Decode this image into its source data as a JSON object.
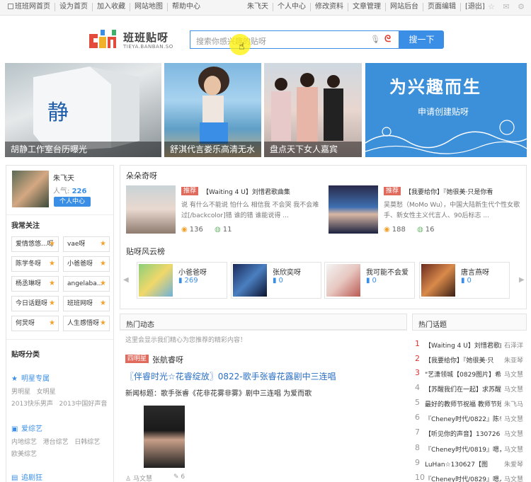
{
  "topbar": {
    "left_links": [
      "班班网首页",
      "设为首页",
      "加入收藏",
      "网站地图",
      "帮助中心"
    ],
    "right_links": [
      "朱飞天",
      "个人中心",
      "修改资料",
      "文章管理",
      "网站后台",
      "页面编辑",
      "[退出]"
    ],
    "icons": [
      "pin-icon",
      "star-icon",
      "mail-icon",
      "settings-icon"
    ]
  },
  "logo": {
    "cn": "班班贴呀",
    "en": "TIEYA.BANBAN.SO"
  },
  "search": {
    "placeholder": "搜索你感兴趣的贴呀",
    "button": "搜一下"
  },
  "banners": [
    {
      "caption": "胡静工作室台历曝光"
    },
    {
      "caption": "舒淇代言娄乐高清无水"
    },
    {
      "caption": "盘点天下女人嘉宾"
    },
    {
      "caption": "",
      "big": "为兴趣而生",
      "sub": "申请创建贴呀"
    }
  ],
  "user": {
    "name": "朱飞天",
    "popular_label": "人气:",
    "popular_value": "226",
    "center_button": "个人中心"
  },
  "follow": {
    "title": "我常关注",
    "items": [
      "爱情悠悠...呀",
      "vae呀",
      "陈学冬呀",
      "小爸爸呀",
      "杨丞琳呀",
      "angelaba...",
      "今日话题呀",
      "班班网呀",
      "何炅呀",
      "人生感悟呀"
    ]
  },
  "categories": {
    "title": "贴呀分类",
    "groups": [
      {
        "name": "明星专属",
        "subs": [
          "男明星",
          "女明星",
          "2013快乐男声",
          "2013中国好声音"
        ]
      },
      {
        "name": "爱综艺",
        "subs": [
          "内地综艺",
          "港台综艺",
          "日韩综艺",
          "欧美综艺"
        ]
      },
      {
        "name": "追剧狂",
        "subs": []
      }
    ]
  },
  "duoduo": {
    "title": "朵朵奇呀",
    "items": [
      {
        "badge": "推荐",
        "title": "【Waiting 4 U】刘惜君歌曲集",
        "desc": "说 有什么不能说 怕什么 相信我 不会哭 我不会难过[/backcolor]错 谁的错 谁能说得 ...",
        "views": "136",
        "comments": "11"
      },
      {
        "badge": "推荐",
        "title": "【我要给你】『她很美·只是你看",
        "desc": "吴莫愁（MoMo Wu），中国大陆新生代个性女歌手、新女性主义代言人、90后标志 ...",
        "views": "188",
        "comments": "16"
      }
    ]
  },
  "ranking": {
    "title": "贴呀风云榜",
    "items": [
      {
        "name": "小爸爸呀",
        "count": "269"
      },
      {
        "name": "张欣奕呀",
        "count": "0"
      },
      {
        "name": "我可能不会爱",
        "count": "0"
      },
      {
        "name": "唐言燕呀",
        "count": "0"
      }
    ]
  },
  "dynamics": {
    "title": "热门动态",
    "tip": "这里会显示我们精心为您推荐的精彩内容！",
    "tag": "四明星",
    "name": "张航睿呀",
    "link": "〖伴睿时光☆花睿绽放〗0822-歌手张睿花露剧中三连唱",
    "text": "新闻标题：歌手张睿《花非花雾非雾》剧中三连唱 为爱而歌",
    "author": "马文慧",
    "comments": "6"
  },
  "topics": {
    "title": "热门话题",
    "rows": [
      {
        "n": "1",
        "t": "【Waiting 4 U】刘惜君歌曲",
        "u": "石泽洋"
      },
      {
        "n": "2",
        "t": "【我要给你】『她很美·只",
        "u": "朱亚琴"
      },
      {
        "n": "3",
        "t": "\"艺潇领城【0829图片】希",
        "u": "马文慧"
      },
      {
        "n": "4",
        "t": "【苏醒我们在一起】求苏醒",
        "u": "马文慧"
      },
      {
        "n": "5",
        "t": "最好的教师节祝福 教师节短",
        "u": "朱飞马"
      },
      {
        "n": "6",
        "t": "『Cheney时代/0822』陈冬",
        "u": "马文慧"
      },
      {
        "n": "7",
        "t": "【听见你的声音】130726",
        "u": "马文慧"
      },
      {
        "n": "8",
        "t": "『Cheney时代/0819』嗯，",
        "u": "马文慧"
      },
      {
        "n": "9",
        "t": "LuHan☆130627【图",
        "u": "朱爱琴"
      },
      {
        "n": "10",
        "t": "『Cheney时代/0829』嗯人",
        "u": "马文慧"
      }
    ]
  }
}
